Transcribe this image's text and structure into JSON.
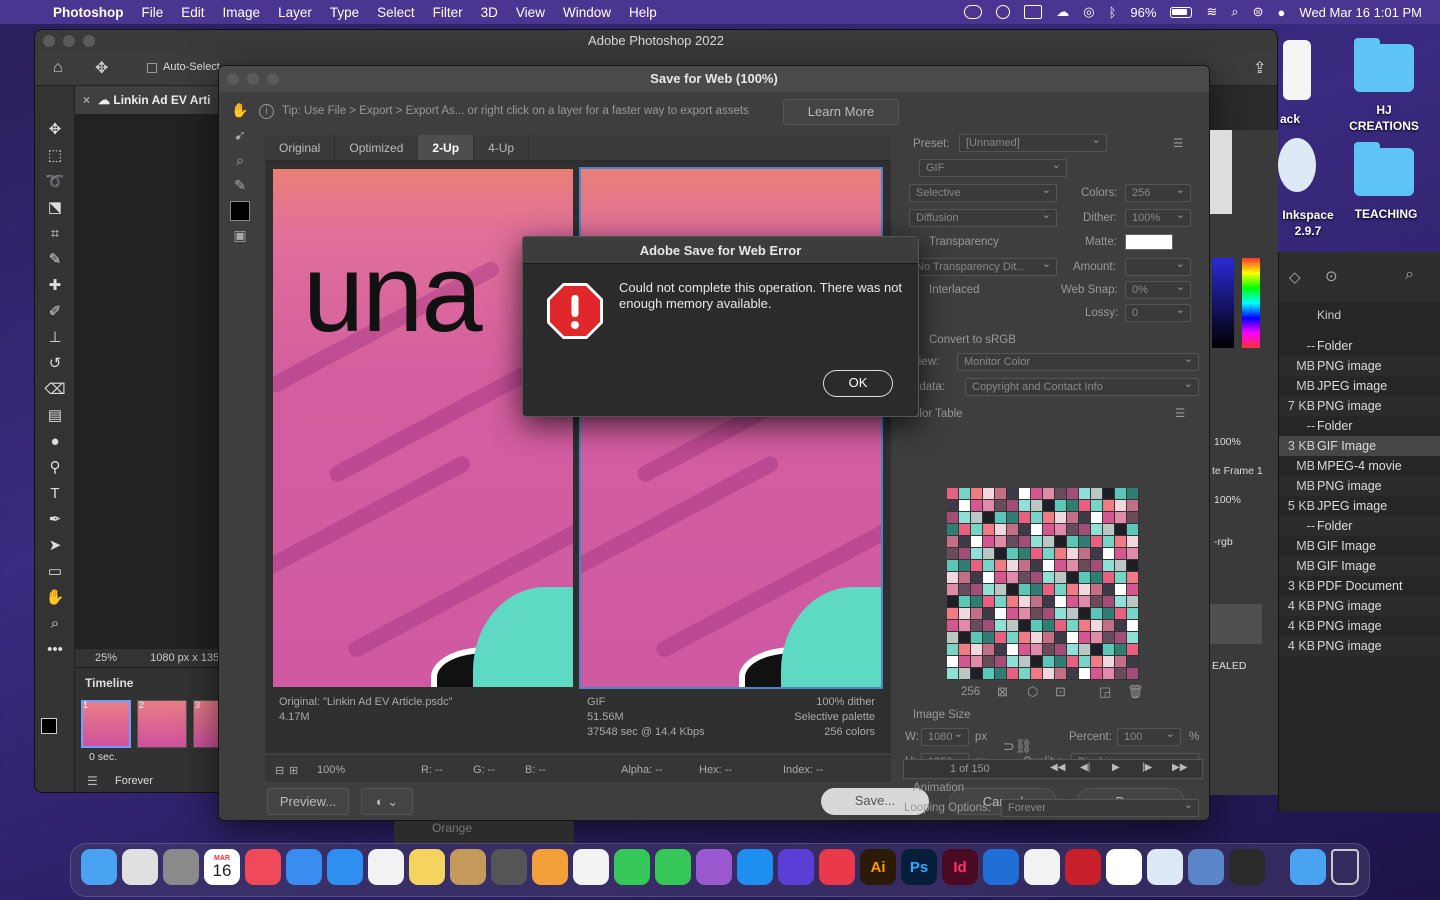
{
  "menubar": {
    "app": "Photoshop",
    "items": [
      "File",
      "Edit",
      "Image",
      "Layer",
      "Type",
      "Select",
      "Filter",
      "3D",
      "View",
      "Window",
      "Help"
    ],
    "battery": "96%",
    "datetime": "Wed Mar 16  1:01 PM"
  },
  "desktop": {
    "hj_creations": "HJ\nCREATIONS",
    "teaching": "TEACHING",
    "inkspace": "Inkspace\n2.9.7",
    "back_label": "ack"
  },
  "photoshop": {
    "window_title": "Adobe Photoshop 2022",
    "auto_select": "Auto-Select",
    "doc_tab": "Linkin Ad EV Arti",
    "zoom": "25%",
    "doc_size": "1080 px x 135",
    "timeline_label": "Timeline",
    "frame_delay": "0 sec.",
    "loop": "Forever",
    "frames": [
      "1",
      "2",
      "3"
    ]
  },
  "sfw": {
    "title": "Save for Web (100%)",
    "tip": "Tip: Use File > Export > Export As...  or right click on a layer for a faster way to export assets",
    "learn_more": "Learn More",
    "tabs": [
      "Original",
      "Optimized",
      "2-Up",
      "4-Up"
    ],
    "active_tab": "2-Up",
    "preview_text": "una",
    "original_info": {
      "line1": "Original: \"Linkin Ad EV Article.psdc\"",
      "line2": "4.17M"
    },
    "optimized_info": {
      "format": "GIF",
      "size": "51.56M",
      "time": "37548 sec @ 14.4 Kbps",
      "dither": "100% dither",
      "palette": "Selective palette",
      "colors": "256 colors"
    },
    "status": {
      "zoom": "100%",
      "r": "R: --",
      "g": "G: --",
      "b": "B: --",
      "alpha": "Alpha: --",
      "hex": "Hex: --",
      "index": "Index: --"
    },
    "preview_btn": "Preview...",
    "save_btn": "Save...",
    "cancel_btn": "Cancel",
    "done_btn": "Done",
    "settings": {
      "preset_label": "Preset:",
      "preset": "[Unnamed]",
      "format": "GIF",
      "reduction": "Selective",
      "colors_label": "Colors:",
      "colors": "256",
      "dither_algo": "Diffusion",
      "dither_label": "Dither:",
      "dither": "100%",
      "transparency": "Transparency",
      "matte_label": "Matte:",
      "trans_dither": "No Transparency Dit...",
      "amount_label": "Amount:",
      "interlaced": "Interlaced",
      "websnap_label": "Web Snap:",
      "websnap": "0%",
      "lossy_label": "Lossy:",
      "lossy": "0",
      "convert_srgb": "Convert to sRGB",
      "preview_label": "view:",
      "preview": "Monitor Color",
      "metadata_label": "adata:",
      "metadata": "Copyright and Contact Info",
      "color_table": "olor Table",
      "table_count": "256",
      "image_size": "Image Size",
      "w_label": "W:",
      "w": "1080",
      "h_label": "H:",
      "h": "1350",
      "px": "px",
      "percent_label": "Percent:",
      "percent": "100",
      "pct": "%",
      "quality_label": "Quality:",
      "quality": "Bicubic",
      "animation": "Animation",
      "looping_label": "Looping Options:",
      "looping": "Forever",
      "frame_counter": "1 of 150"
    }
  },
  "alert": {
    "title": "Adobe Save for Web Error",
    "message": "Could not complete this operation. There was not enough memory available.",
    "ok": "OK"
  },
  "side_panel": {
    "zoom1": "100%",
    "frame": "te Frame 1",
    "zoom2": "100%",
    "rgb": "-rgb",
    "sealed": "EALED"
  },
  "finder": {
    "kind_header": "Kind",
    "rows": [
      {
        "size": "--",
        "kind": "Folder"
      },
      {
        "size": "MB",
        "kind": "PNG image"
      },
      {
        "size": "MB",
        "kind": "JPEG image"
      },
      {
        "size": "7 KB",
        "kind": "PNG image"
      },
      {
        "size": "--",
        "kind": "Folder"
      },
      {
        "size": "3 KB",
        "kind": "GIF Image"
      },
      {
        "size": "MB",
        "kind": "MPEG-4 movie"
      },
      {
        "size": "MB",
        "kind": "PNG image"
      },
      {
        "size": "5 KB",
        "kind": "JPEG image"
      },
      {
        "size": "--",
        "kind": "Folder"
      },
      {
        "size": "MB",
        "kind": "GIF Image"
      },
      {
        "size": "MB",
        "kind": "GIF Image"
      },
      {
        "size": "3 KB",
        "kind": "PDF Document"
      },
      {
        "size": "4 KB",
        "kind": "PNG image"
      },
      {
        "size": "4 KB",
        "kind": "PNG image"
      },
      {
        "size": "4 KB",
        "kind": "PNG image"
      }
    ],
    "bottom_text": "Orange"
  },
  "dock": {
    "calendar_month": "MAR",
    "calendar_day": "16",
    "apps": [
      "finder-icon",
      "launchpad-icon",
      "system-preferences-icon",
      "calendar-icon",
      "music-icon",
      "mail-icon",
      "safari-icon",
      "chrome-icon",
      "notes-icon",
      "contacts-icon",
      "calculator-icon",
      "pages-icon",
      "photos-icon",
      "messages-icon",
      "facetime-icon",
      "podcasts-icon",
      "app-store-icon",
      "siri-icon",
      "creative-cloud-icon",
      "illustrator-icon",
      "photoshop-icon",
      "indesign-icon",
      "vscode-icon",
      "slack-icon",
      "acrobat-icon",
      "word-icon",
      "inkscape-icon",
      "preview-icon",
      "quicktime-icon",
      "downloads-folder-icon",
      "trash-icon"
    ],
    "ai": "Ai",
    "ps": "Ps",
    "id": "Id"
  }
}
